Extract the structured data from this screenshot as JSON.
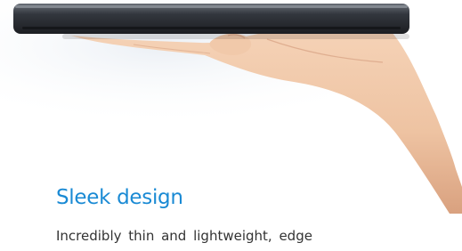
{
  "heading": {
    "text": "Sleek design",
    "color": "#1a8ad4"
  },
  "body": {
    "text": "Incredibly thin and lightweight, edge",
    "color": "#333333"
  },
  "photo": {
    "subject": "hand holding tablet edge-on",
    "device_color": "#2a2d33",
    "skin_color": "#f0c7a7"
  }
}
